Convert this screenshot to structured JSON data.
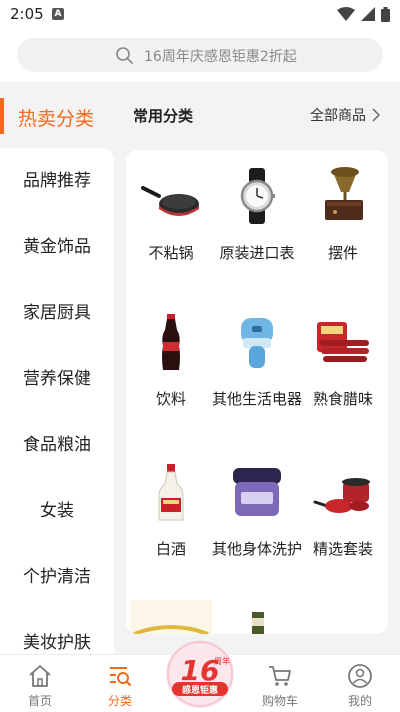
{
  "status_bar": {
    "time": "2:05",
    "app_badge": "A"
  },
  "search": {
    "placeholder": "16周年庆感恩钜惠2折起"
  },
  "header": {
    "hot_category": "热卖分类",
    "section_title": "常用分类",
    "all_goods": "全部商品"
  },
  "sidebar": {
    "items": [
      {
        "label": "品牌推荐"
      },
      {
        "label": "黄金饰品"
      },
      {
        "label": "家居厨具"
      },
      {
        "label": "营养保健"
      },
      {
        "label": "食品粮油"
      },
      {
        "label": "女装"
      },
      {
        "label": "个护清洁"
      },
      {
        "label": "美妆护肤"
      }
    ]
  },
  "categories": [
    {
      "label": "不粘锅",
      "icon": "frying-pan-icon"
    },
    {
      "label": "原装进口表",
      "icon": "wristwatch-icon"
    },
    {
      "label": "摆件",
      "icon": "gramophone-icon"
    },
    {
      "label": "饮料",
      "icon": "cola-bottle-icon"
    },
    {
      "label": "其他生活电器",
      "icon": "lint-remover-icon"
    },
    {
      "label": "熟食腊味",
      "icon": "sausage-icon"
    },
    {
      "label": "白酒",
      "icon": "liquor-bottle-icon"
    },
    {
      "label": "其他身体洗护",
      "icon": "body-scrub-jar-icon"
    },
    {
      "label": "精选套装",
      "icon": "cookware-set-icon"
    }
  ],
  "bottom_nav": {
    "items": [
      {
        "label": "首页",
        "icon": "home-icon"
      },
      {
        "label": "分类",
        "icon": "category-search-icon",
        "active": true
      },
      {
        "label": "购物车",
        "icon": "cart-icon"
      },
      {
        "label": "我的",
        "icon": "profile-icon"
      }
    ],
    "promo_badge": {
      "number": "16",
      "line1": "周年",
      "line2": "感恩钜惠"
    }
  },
  "colors": {
    "accent": "#f26a1b",
    "background": "#f3f3f3"
  }
}
